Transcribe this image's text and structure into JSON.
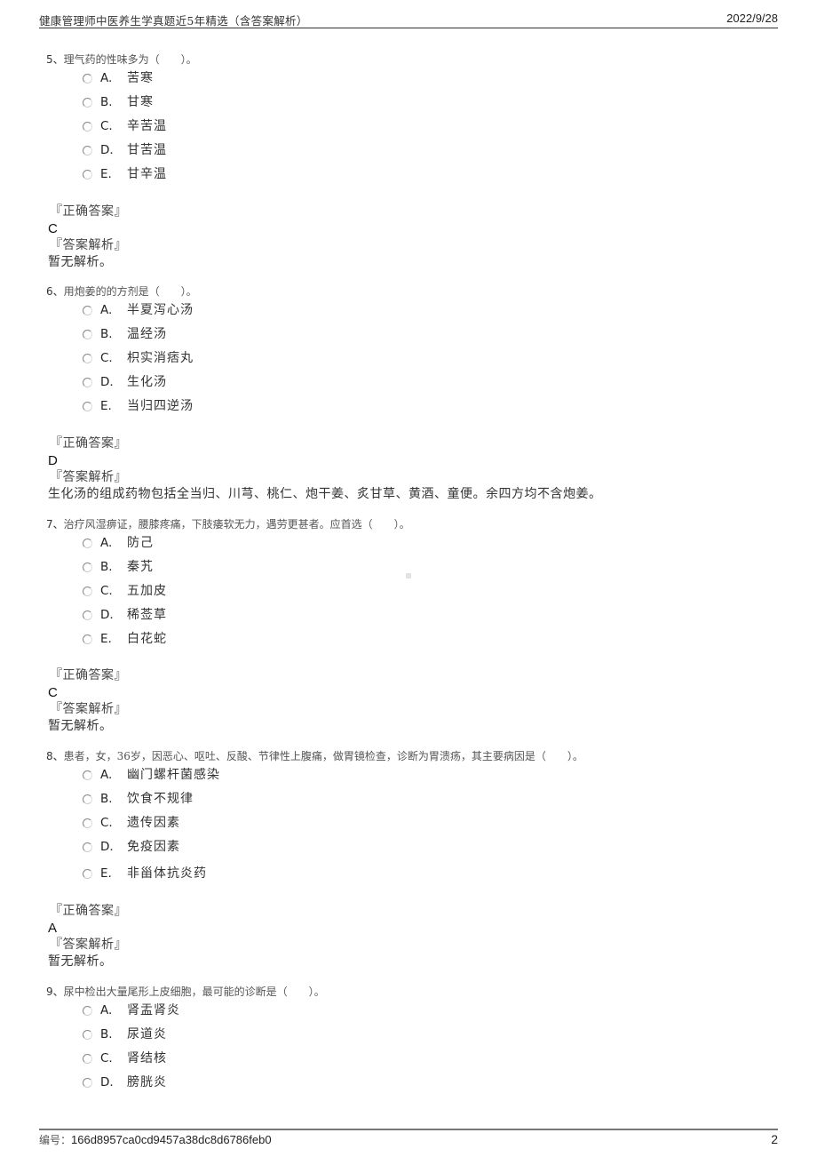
{
  "header": {
    "title": "健康管理师中医养生学真题近5年精选（含答案解析）",
    "date": "2022/9/28"
  },
  "labels": {
    "correct_answer": "『正确答案』",
    "analysis": "『答案解析』"
  },
  "questions": [
    {
      "number": "5、",
      "stem": "理气药的性味多为（　　）。",
      "options": [
        {
          "letter": "A.",
          "text": "苦寒"
        },
        {
          "letter": "B.",
          "text": "甘寒"
        },
        {
          "letter": "C.",
          "text": "辛苦温"
        },
        {
          "letter": "D.",
          "text": "甘苦温"
        },
        {
          "letter": "E.",
          "text": "甘辛温"
        }
      ],
      "answer": "C",
      "analysis": "暂无解析。"
    },
    {
      "number": "6、",
      "stem": "用炮姜的的方剂是（　　）。",
      "options": [
        {
          "letter": "A.",
          "text": "半夏泻心汤"
        },
        {
          "letter": "B.",
          "text": "温经汤"
        },
        {
          "letter": "C.",
          "text": "枳实消痞丸"
        },
        {
          "letter": "D.",
          "text": "生化汤"
        },
        {
          "letter": "E.",
          "text": "当归四逆汤"
        }
      ],
      "answer": "D",
      "analysis": "生化汤的组成药物包括全当归、川芎、桃仁、炮干姜、炙甘草、黄酒、童便。余四方均不含炮姜。"
    },
    {
      "number": "7、",
      "stem": "治疗风湿痹证，腰膝疼痛，下肢痿软无力，遇劳更甚者。应首选（　　）。",
      "options": [
        {
          "letter": "A.",
          "text": "防己"
        },
        {
          "letter": "B.",
          "text": "秦艽"
        },
        {
          "letter": "C.",
          "text": "五加皮"
        },
        {
          "letter": "D.",
          "text": "稀莶草"
        },
        {
          "letter": "E.",
          "text": "白花蛇"
        }
      ],
      "answer": "C",
      "analysis": "暂无解析。"
    },
    {
      "number": "8、",
      "stem": "患者，女，36岁，因恶心、呕吐、反酸、节律性上腹痛，做胃镜检查，诊断为胃溃疡，其主要病因是（　　）。",
      "options": [
        {
          "letter": "A.",
          "text": "幽门螺杆菌感染"
        },
        {
          "letter": "B.",
          "text": "饮食不规律"
        },
        {
          "letter": "C.",
          "text": "遗传因素"
        },
        {
          "letter": "D.",
          "text": "免疫因素"
        },
        {
          "letter": "E.",
          "text": "非甾体抗炎药"
        }
      ],
      "answer": "A",
      "analysis": "暂无解析。"
    },
    {
      "number": "9、",
      "stem": "尿中检出大量尾形上皮细胞，最可能的诊断是（　　）。",
      "options": [
        {
          "letter": "A.",
          "text": "肾盂肾炎"
        },
        {
          "letter": "B.",
          "text": "尿道炎"
        },
        {
          "letter": "C.",
          "text": "肾结核"
        },
        {
          "letter": "D.",
          "text": "膀胱炎"
        }
      ]
    }
  ],
  "footer": {
    "id_label": "编号：",
    "id_value": "166d8957ca0cd9457a38dc8d6786feb0",
    "page_number": "2"
  }
}
